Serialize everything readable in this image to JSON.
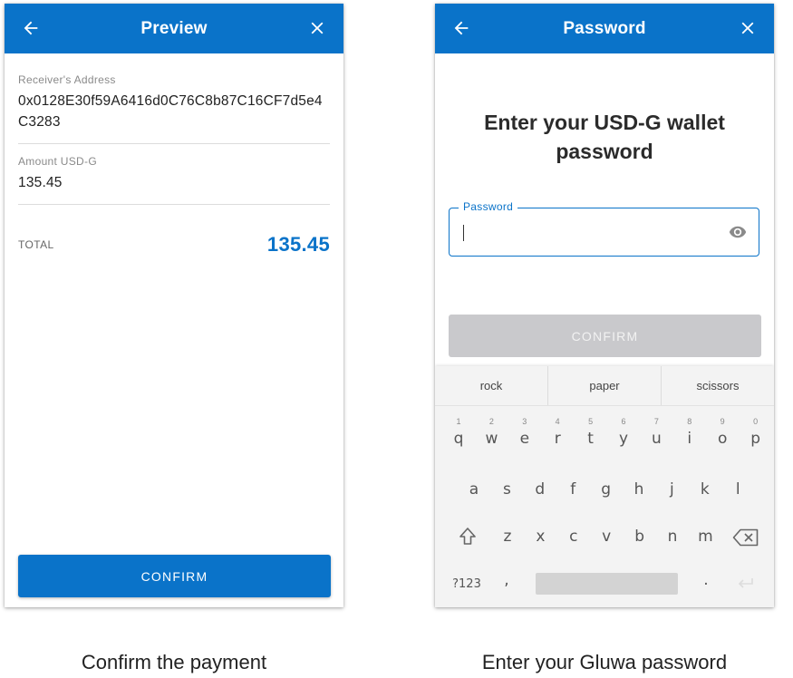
{
  "preview": {
    "title": "Preview",
    "receiver_label": "Receiver's Address",
    "receiver_value": "0x0128E30f59A6416d0C76C8b87C16CF7d5e4C3283",
    "amount_label": "Amount USD-G",
    "amount_value": "135.45",
    "total_label": "TOTAL",
    "total_value": "135.45",
    "confirm_label": "CONFIRM",
    "caption": "Confirm the payment"
  },
  "password": {
    "title": "Password",
    "heading": "Enter your USD-G wallet password",
    "field_label": "Password",
    "confirm_label": "CONFIRM",
    "caption": "Enter your Gluwa password"
  },
  "keyboard": {
    "suggestions": [
      "rock",
      "paper",
      "scissors"
    ],
    "row1": [
      {
        "ch": "q",
        "hint": "1"
      },
      {
        "ch": "w",
        "hint": "2"
      },
      {
        "ch": "e",
        "hint": "3"
      },
      {
        "ch": "r",
        "hint": "4"
      },
      {
        "ch": "t",
        "hint": "5"
      },
      {
        "ch": "y",
        "hint": "6"
      },
      {
        "ch": "u",
        "hint": "7"
      },
      {
        "ch": "i",
        "hint": "8"
      },
      {
        "ch": "o",
        "hint": "9"
      },
      {
        "ch": "p",
        "hint": "0"
      }
    ],
    "row2": [
      "a",
      "s",
      "d",
      "f",
      "g",
      "h",
      "j",
      "k",
      "l"
    ],
    "row3": [
      "z",
      "x",
      "c",
      "v",
      "b",
      "n",
      "m"
    ],
    "symbols_label": "?123",
    "comma": ",",
    "period": "."
  },
  "colors": {
    "accent": "#0a73c9",
    "disabled": "#c9c9cc"
  }
}
